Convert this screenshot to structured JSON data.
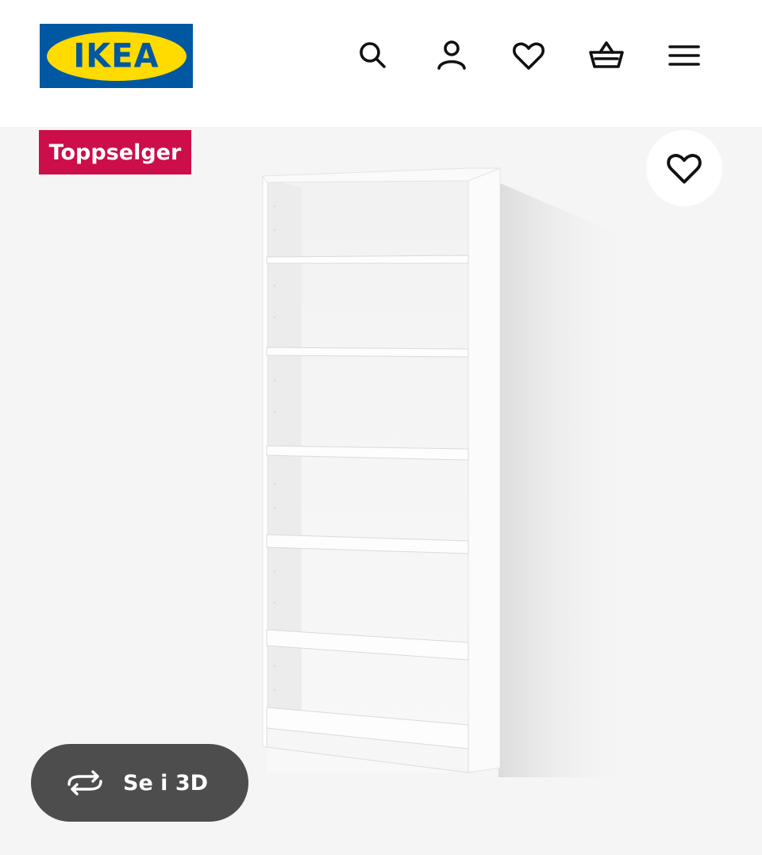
{
  "header": {
    "logo_text": "IKEA",
    "logo_colors": {
      "blue": "#0058a3",
      "yellow": "#ffdb00"
    },
    "icons": [
      "search-icon",
      "user-icon",
      "heart-icon",
      "basket-icon",
      "menu-icon"
    ]
  },
  "product": {
    "badge": "Toppselger",
    "badge_color": "#cc0e4a",
    "view_3d_label": "Se i 3D"
  }
}
